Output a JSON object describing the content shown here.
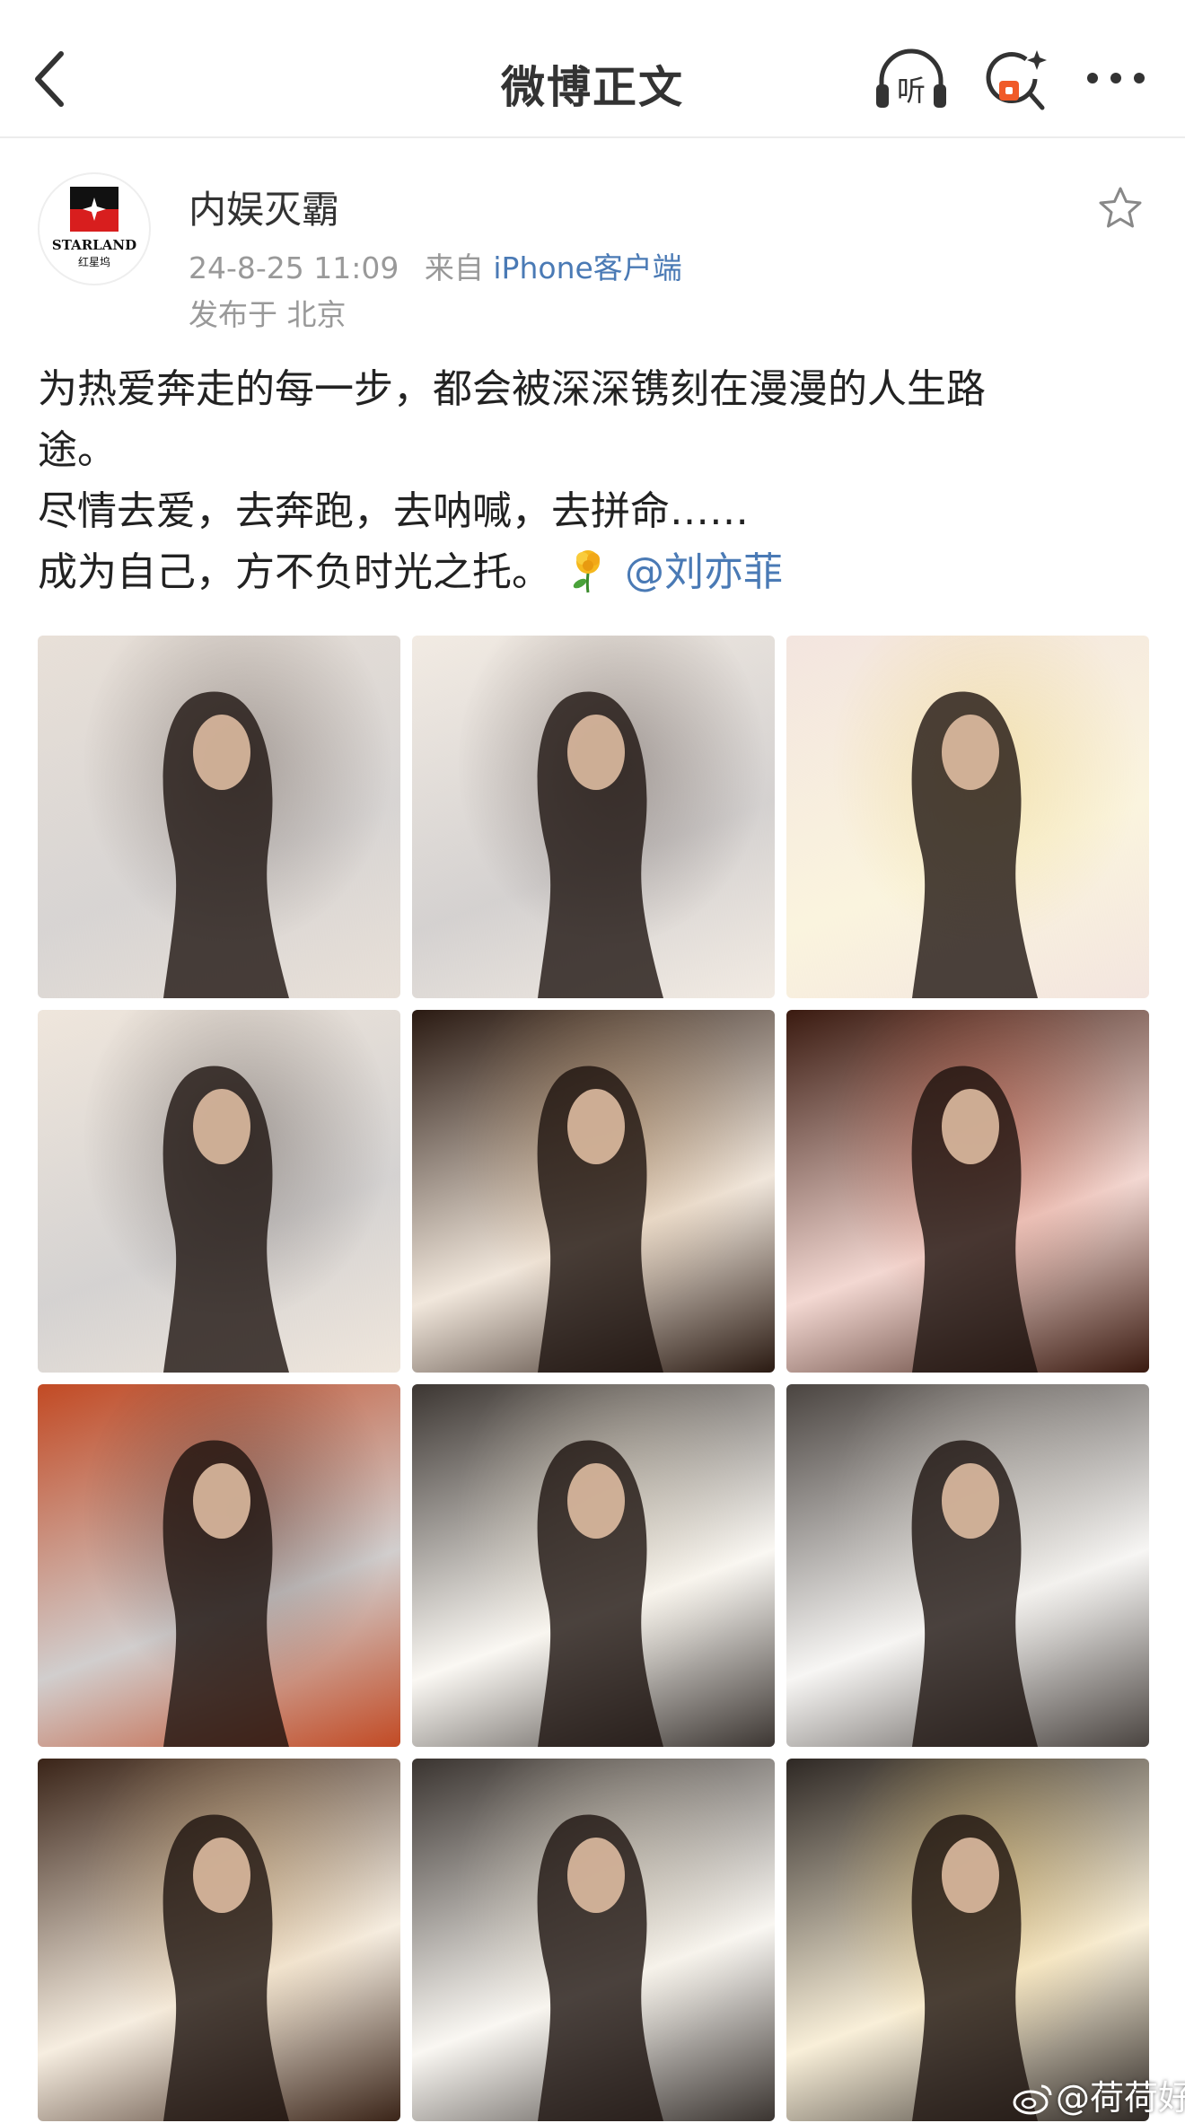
{
  "header": {
    "title": "微博正文",
    "listen_label": "听"
  },
  "author": {
    "name": "内娱灭霸",
    "avatar_brand": "STARLAND",
    "avatar_sub": "红星坞",
    "time": "24-8-25 11:09",
    "from_prefix": "来自",
    "source": "iPhone客户端",
    "location": "发布于 北京"
  },
  "post": {
    "line1": "为热爱奔走的每一步，都会被深深镌刻在漫漫的人生路",
    "line2": "途。",
    "line3": "尽情去爱，去奔跑，去呐喊，去拼命……",
    "line4": "成为自己，方不负时光之托。",
    "mention": "@刘亦菲"
  },
  "photos": [
    {
      "name": "photo-bed-rose",
      "bg": "#e8e0d8",
      "accent": "#3a2a22"
    },
    {
      "name": "photo-yellow-rose-mouth",
      "bg": "#f2ebe3",
      "accent": "#2a1a14"
    },
    {
      "name": "photo-closeup-profile",
      "bg": "#f3e5df",
      "accent": "#e8c85a"
    },
    {
      "name": "photo-reading-bed",
      "bg": "#efe6dc",
      "accent": "#2b1f1a"
    },
    {
      "name": "photo-dark-portrait",
      "bg": "#2a1a12",
      "accent": "#b8864e"
    },
    {
      "name": "photo-sunset-motorbike",
      "bg": "#3a1a10",
      "accent": "#c23a1c"
    },
    {
      "name": "photo-red-jacket-sunglasses",
      "bg": "#c24a24",
      "accent": "#1a0a08"
    },
    {
      "name": "photo-drums-1",
      "bg": "#3c3632",
      "accent": "#e8dcc4"
    },
    {
      "name": "photo-drums-2",
      "bg": "#4a4440",
      "accent": "#d8d2c8"
    },
    {
      "name": "photo-theater",
      "bg": "#3a2418",
      "accent": "#d4a866"
    },
    {
      "name": "photo-drums-3",
      "bg": "#3a3430",
      "accent": "#e4d8c0"
    },
    {
      "name": "photo-drums-gold",
      "bg": "#2e2824",
      "accent": "#e0b040"
    }
  ],
  "watermark": "@荷荷好",
  "colors": {
    "link": "#4a7ab5",
    "meta": "#999999",
    "text": "#222222"
  }
}
